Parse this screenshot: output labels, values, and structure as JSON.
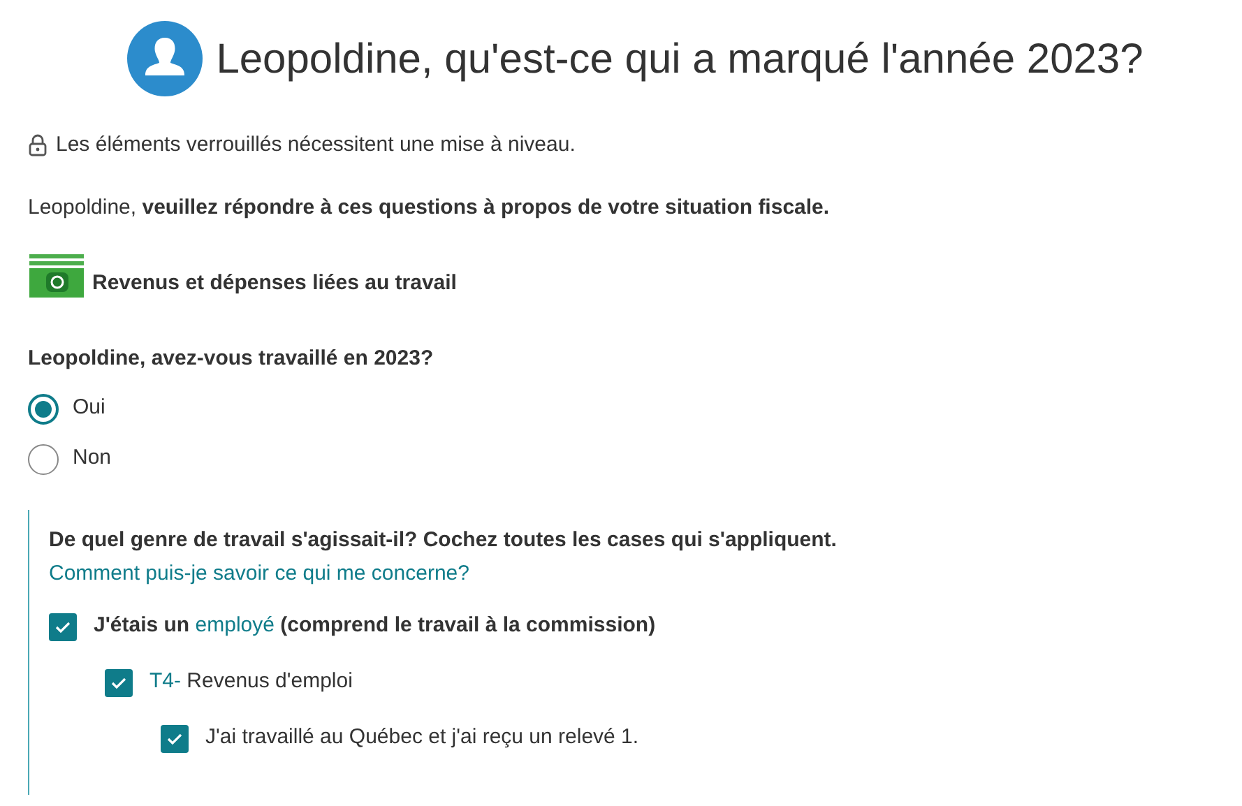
{
  "header": {
    "title": "Leopoldine, qu'est-ce qui a marqué l'année 2023?"
  },
  "notice": "Les éléments verrouillés nécessitent une mise à niveau.",
  "intro": "Leopoldine, **veuillez répondre à ces questions à propos de votre situation fiscale.**",
  "section": {
    "title": "Revenus et dépenses liées au travail"
  },
  "question": {
    "text": "Leopoldine, avez-vous travaillé en 2023?",
    "options": [
      {
        "label": "Oui",
        "selected": true
      },
      {
        "label": "Non",
        "selected": false
      }
    ]
  },
  "follow_up": {
    "prompt": "De quel genre de travail s'agissait-il? Cochez toutes les cases qui s'appliquent.",
    "help_link": "Comment puis-je savoir ce qui me concerne?",
    "checkboxes": [
      {
        "checked": true,
        "parts": [
          {
            "kind": "bold",
            "text": "J'étais un"
          },
          {
            "kind": "link",
            "text": "employé"
          },
          {
            "kind": "bold",
            "text": "(comprend le travail à la commission)"
          }
        ],
        "children": [
          {
            "checked": true,
            "parts": [
              {
                "kind": "link",
                "text": "T4-"
              },
              {
                "kind": "plain",
                "text": "Revenus d'emploi"
              }
            ],
            "children": [
              {
                "checked": true,
                "parts": [
                  {
                    "kind": "plain",
                    "text": "J'ai travaillé au Québec et j'ai reçu un relevé 1."
                  }
                ]
              }
            ]
          }
        ]
      }
    ]
  }
}
